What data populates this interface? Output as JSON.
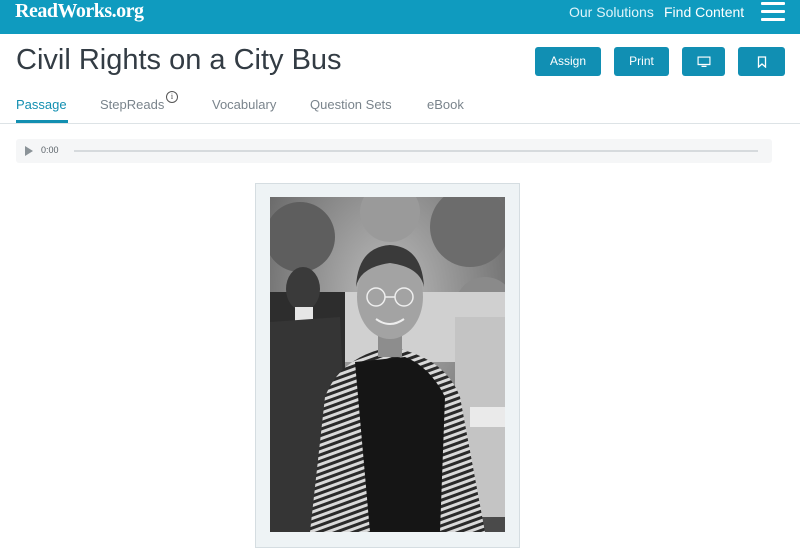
{
  "header": {
    "logo": "ReadWorks.org",
    "nav": {
      "solutions": "Our Solutions",
      "find_content": "Find Content"
    },
    "menu_icon": "hamburger-menu-icon"
  },
  "page": {
    "title": "Civil Rights on a City Bus"
  },
  "actions": {
    "assign": "Assign",
    "print": "Print",
    "present_icon": "monitor-icon",
    "bookmark_icon": "bookmark-icon"
  },
  "tabs": [
    {
      "label": "Passage",
      "active": true
    },
    {
      "label": "StepReads",
      "info_icon": "i"
    },
    {
      "label": "Vocabulary"
    },
    {
      "label": "Question Sets"
    },
    {
      "label": "eBook"
    }
  ],
  "audio": {
    "play_icon": "play-icon",
    "time": "0:00"
  },
  "colors": {
    "brand": "#0f9bbf",
    "button": "#118fb3",
    "active_tab": "#128fb1"
  }
}
